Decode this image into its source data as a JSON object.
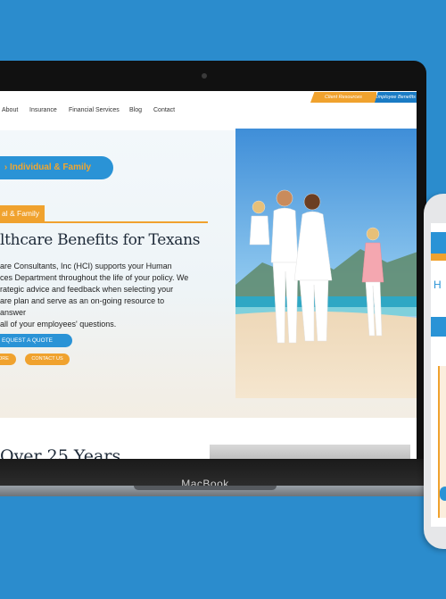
{
  "device": {
    "brand_label": "MacBook"
  },
  "nav": {
    "links": [
      "About",
      "Insurance",
      "Financial Services",
      "Blog",
      "Contact"
    ],
    "ribbons": {
      "client": "Client Resources",
      "employee": "Employee Benefits Specialists"
    }
  },
  "hero": {
    "individual_button": "Individual & Family",
    "tag": "al & Family",
    "title": "lthcare Benefits for Texans",
    "paragraph": "are Consultants, Inc (HCI) supports your Human\nces Department throughout the life of your policy. We\nrategic advice and feedback when selecting your\nare plan and serve as an on-going resource to answer\n all of your employees' questions.",
    "quote_button": "EQUEST A QUOTE",
    "more_button": "ORE",
    "contact_button": "CONTACT US"
  },
  "section2": {
    "title": "Over 25 Years"
  },
  "phone": {
    "header": "H"
  },
  "colors": {
    "accent_blue": "#2a93d6",
    "accent_orange": "#f0a22e",
    "background": "#2b8ccd"
  },
  "icons": {
    "chevron": "chevron-right-icon"
  }
}
